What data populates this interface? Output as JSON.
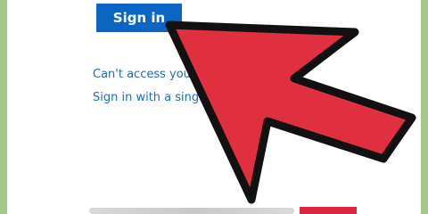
{
  "signin": {
    "button_label": "Sign in"
  },
  "links": {
    "cant_access": "Can't access your acc",
    "single_use": "Sign in with a single-use"
  },
  "colors": {
    "page_bg": "#a3c98f",
    "panel_bg": "#ffffff",
    "button_bg": "#0a66c2",
    "link": "#1f6bb8",
    "arrow_fill": "#e0303f",
    "arrow_outline": "#111111"
  },
  "overlay": {
    "icon": "red-pointer-arrow-icon"
  }
}
